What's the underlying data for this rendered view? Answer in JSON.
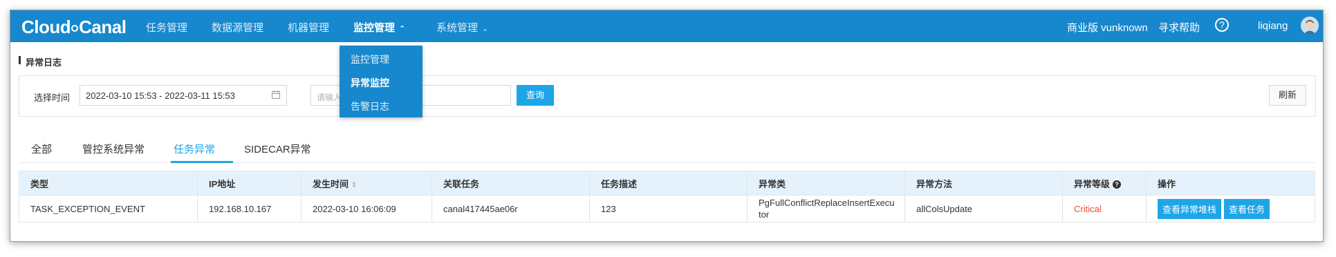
{
  "brand": {
    "logo_text_left": "Cloud",
    "logo_text_right": "Canal"
  },
  "nav": {
    "items": [
      {
        "label": "任务管理"
      },
      {
        "label": "数据源管理"
      },
      {
        "label": "机器管理"
      },
      {
        "label": "监控管理"
      },
      {
        "label": "系统管理"
      }
    ],
    "edition": "商业版 vunknown",
    "help": "寻求帮助",
    "help_icon": "?",
    "user": "liqiang"
  },
  "dropdown": {
    "items": [
      {
        "label": "监控管理"
      },
      {
        "label": "异常监控"
      },
      {
        "label": "告警日志"
      }
    ]
  },
  "page": {
    "section_title": "异常日志"
  },
  "filter": {
    "time_label": "选择时间",
    "time_value": "2022-03-10 15:53 - 2022-03-11 15:53",
    "search_placeholder_visible": "请输入",
    "query_button": "查询",
    "refresh_button": "刷新"
  },
  "tabs": [
    {
      "label": "全部"
    },
    {
      "label": "管控系统异常"
    },
    {
      "label": "任务异常"
    },
    {
      "label": "SIDECAR异常"
    }
  ],
  "table": {
    "headers": [
      "类型",
      "IP地址",
      "发生时间",
      "关联任务",
      "任务描述",
      "异常类",
      "异常方法",
      "异常等级",
      "操作"
    ],
    "rows": [
      {
        "type": "TASK_EXCEPTION_EVENT",
        "ip": "192.168.10.167",
        "time": "2022-03-10 16:06:09",
        "task": "canal417445ae06r",
        "desc": "123",
        "exception_class_line1": "PgFullConflictReplaceInsertExecu",
        "exception_class_line2": "tor",
        "method": "allColsUpdate",
        "level": "Critical",
        "action_stack": "查看异常堆栈",
        "action_task": "查看任务"
      }
    ]
  },
  "colors": {
    "nav_bg": "#1788cd",
    "accent": "#1ea5e8",
    "critical": "#f04a2e"
  }
}
